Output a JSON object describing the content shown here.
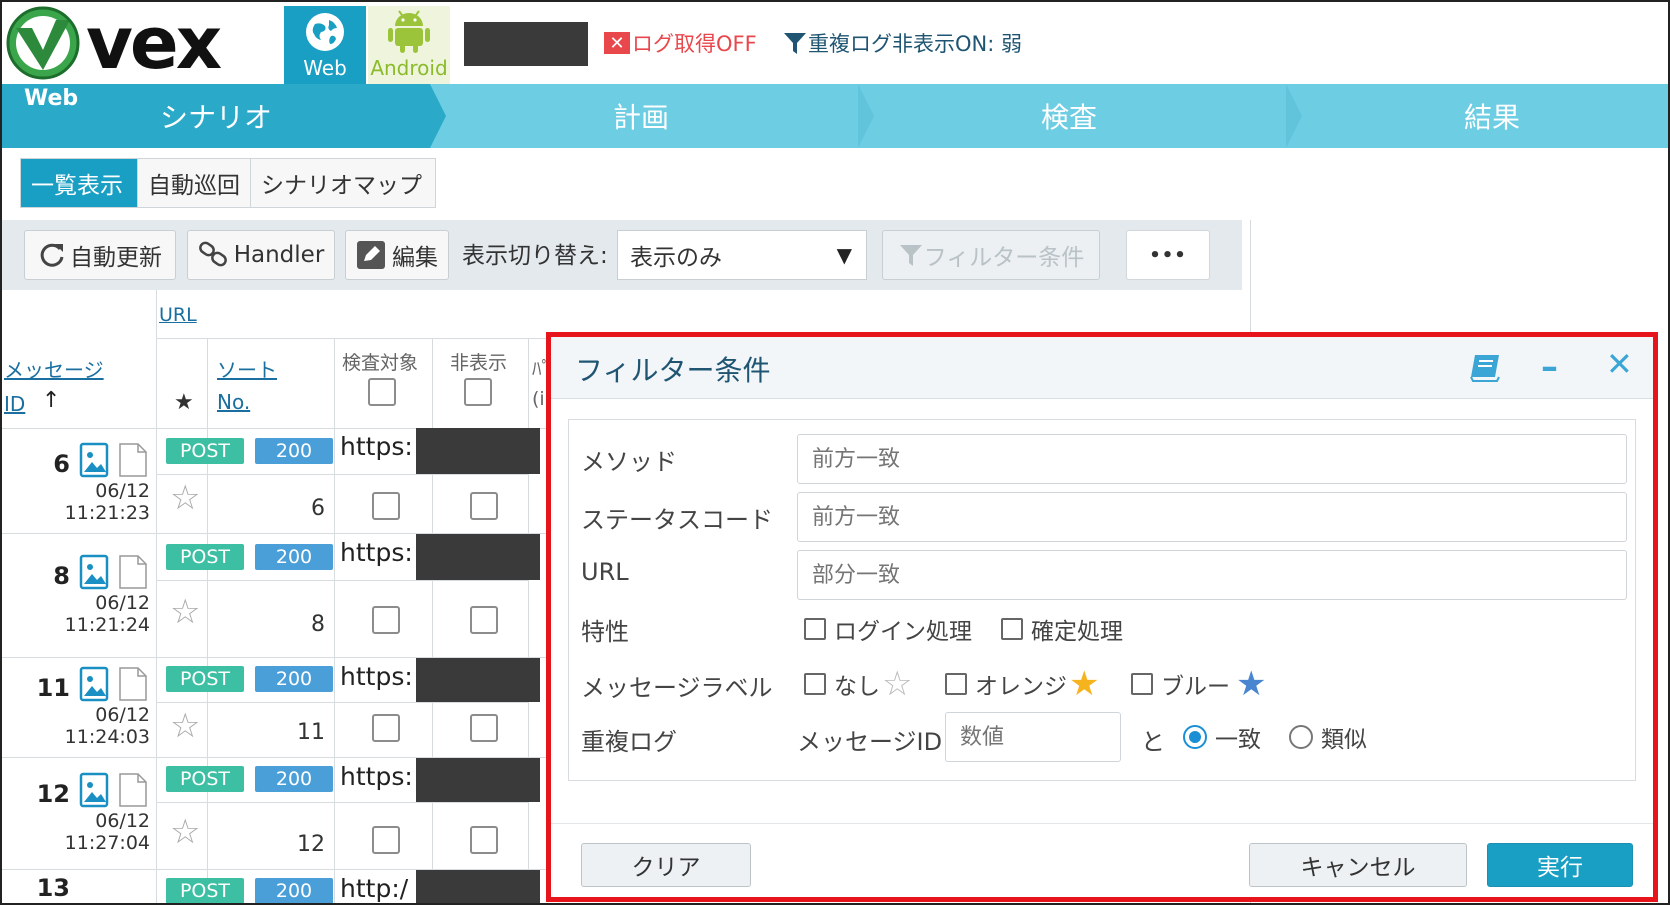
{
  "header": {
    "logo_text": "vex",
    "platforms": [
      {
        "label": "Web",
        "active": true
      },
      {
        "label": "Android",
        "active": false
      }
    ],
    "log_status": "ログ取得OFF",
    "dup_status": "重複ログ非表示ON: 弱"
  },
  "nav": {
    "tag": "Web",
    "steps": [
      "シナリオ",
      "計画",
      "検査",
      "結果"
    ],
    "active_step": "シナリオ"
  },
  "view_tabs": [
    "一覧表示",
    "自動巡回",
    "シナリオマップ"
  ],
  "toolbar": {
    "auto_refresh": "自動更新",
    "handler": "Handler",
    "edit": "編集",
    "display_switch_label": "表示切り替え:",
    "display_switch_value": "表示のみ",
    "filter": "フィルター条件",
    "more": "•••"
  },
  "list": {
    "headers": {
      "url": "URL",
      "message": "メッセージ",
      "id": "ID",
      "sort_arrow": "↑",
      "star": "★",
      "sort": "ソート",
      "no": "No.",
      "inspect": "検査対象",
      "hidden": "非表示",
      "param_partial": "ﾊﾟ",
      "param_open": "(i"
    },
    "rows": [
      {
        "id": "6",
        "date": "06/12",
        "time": "11:21:23",
        "method": "POST",
        "status": "200",
        "url": "https:",
        "no": "6"
      },
      {
        "id": "8",
        "date": "06/12",
        "time": "11:21:24",
        "method": "POST",
        "status": "200",
        "url": "https:",
        "no": "8"
      },
      {
        "id": "11",
        "date": "06/12",
        "time": "11:24:03",
        "method": "POST",
        "status": "200",
        "url": "https:",
        "no": "11"
      },
      {
        "id": "12",
        "date": "06/12",
        "time": "11:27:04",
        "method": "POST",
        "status": "200",
        "url": "https:",
        "no": "12"
      },
      {
        "id": "13",
        "method": "POST",
        "status": "200",
        "url": "http:/"
      }
    ]
  },
  "dialog": {
    "title": "フィルター条件",
    "fields": {
      "method": {
        "label": "メソッド",
        "placeholder": "前方一致"
      },
      "status_code": {
        "label": "ステータスコード",
        "placeholder": "前方一致"
      },
      "url": {
        "label": "URL",
        "placeholder": "部分一致"
      }
    },
    "traits": {
      "label": "特性",
      "options": [
        "ログイン処理",
        "確定処理"
      ]
    },
    "message_label": {
      "label": "メッセージラベル",
      "options": [
        "なし",
        "オレンジ",
        "ブルー"
      ]
    },
    "dup_log": {
      "label": "重複ログ",
      "id_label": "メッセージID",
      "id_placeholder": "数値",
      "conj": "と",
      "options": [
        "一致",
        "類似"
      ],
      "selected": "一致"
    },
    "buttons": {
      "clear": "クリア",
      "cancel": "キャンセル",
      "run": "実行"
    }
  },
  "colors": {
    "accent": "#1a9fc4",
    "nav": "#6ccde3",
    "post": "#3cbfa2",
    "status": "#4a9fd8",
    "highlight_border": "#e8141b",
    "orange_star": "#f5b31e",
    "blue_star": "#4a86cf"
  }
}
